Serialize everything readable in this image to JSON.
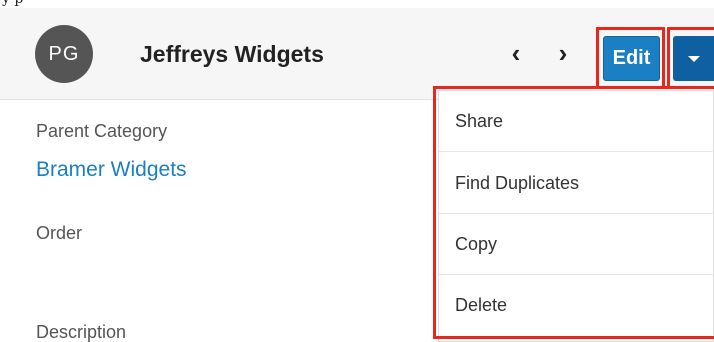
{
  "top_fragment": "y   p",
  "record": {
    "avatar_initials": "PG",
    "name": "Jeffreys Widgets"
  },
  "header": {
    "prev_icon": "chevron-left-icon",
    "next_icon": "chevron-right-icon",
    "prev_label": "‹",
    "next_label": "›",
    "edit_label": "Edit",
    "actions_icon": "caret-down-icon"
  },
  "fields": {
    "parent_category_label": "Parent Category",
    "parent_category_value": "Bramer Widgets",
    "order_label": "Order",
    "description_label": "Description"
  },
  "actions_menu": {
    "items": [
      {
        "label": "Share"
      },
      {
        "label": "Find Duplicates"
      },
      {
        "label": "Copy"
      },
      {
        "label": "Delete"
      }
    ]
  },
  "colors": {
    "accent_blue": "#1b7fc4",
    "dark_blue": "#0f5fa3",
    "highlight_red": "#e8261b",
    "avatar_gray": "#555555"
  }
}
